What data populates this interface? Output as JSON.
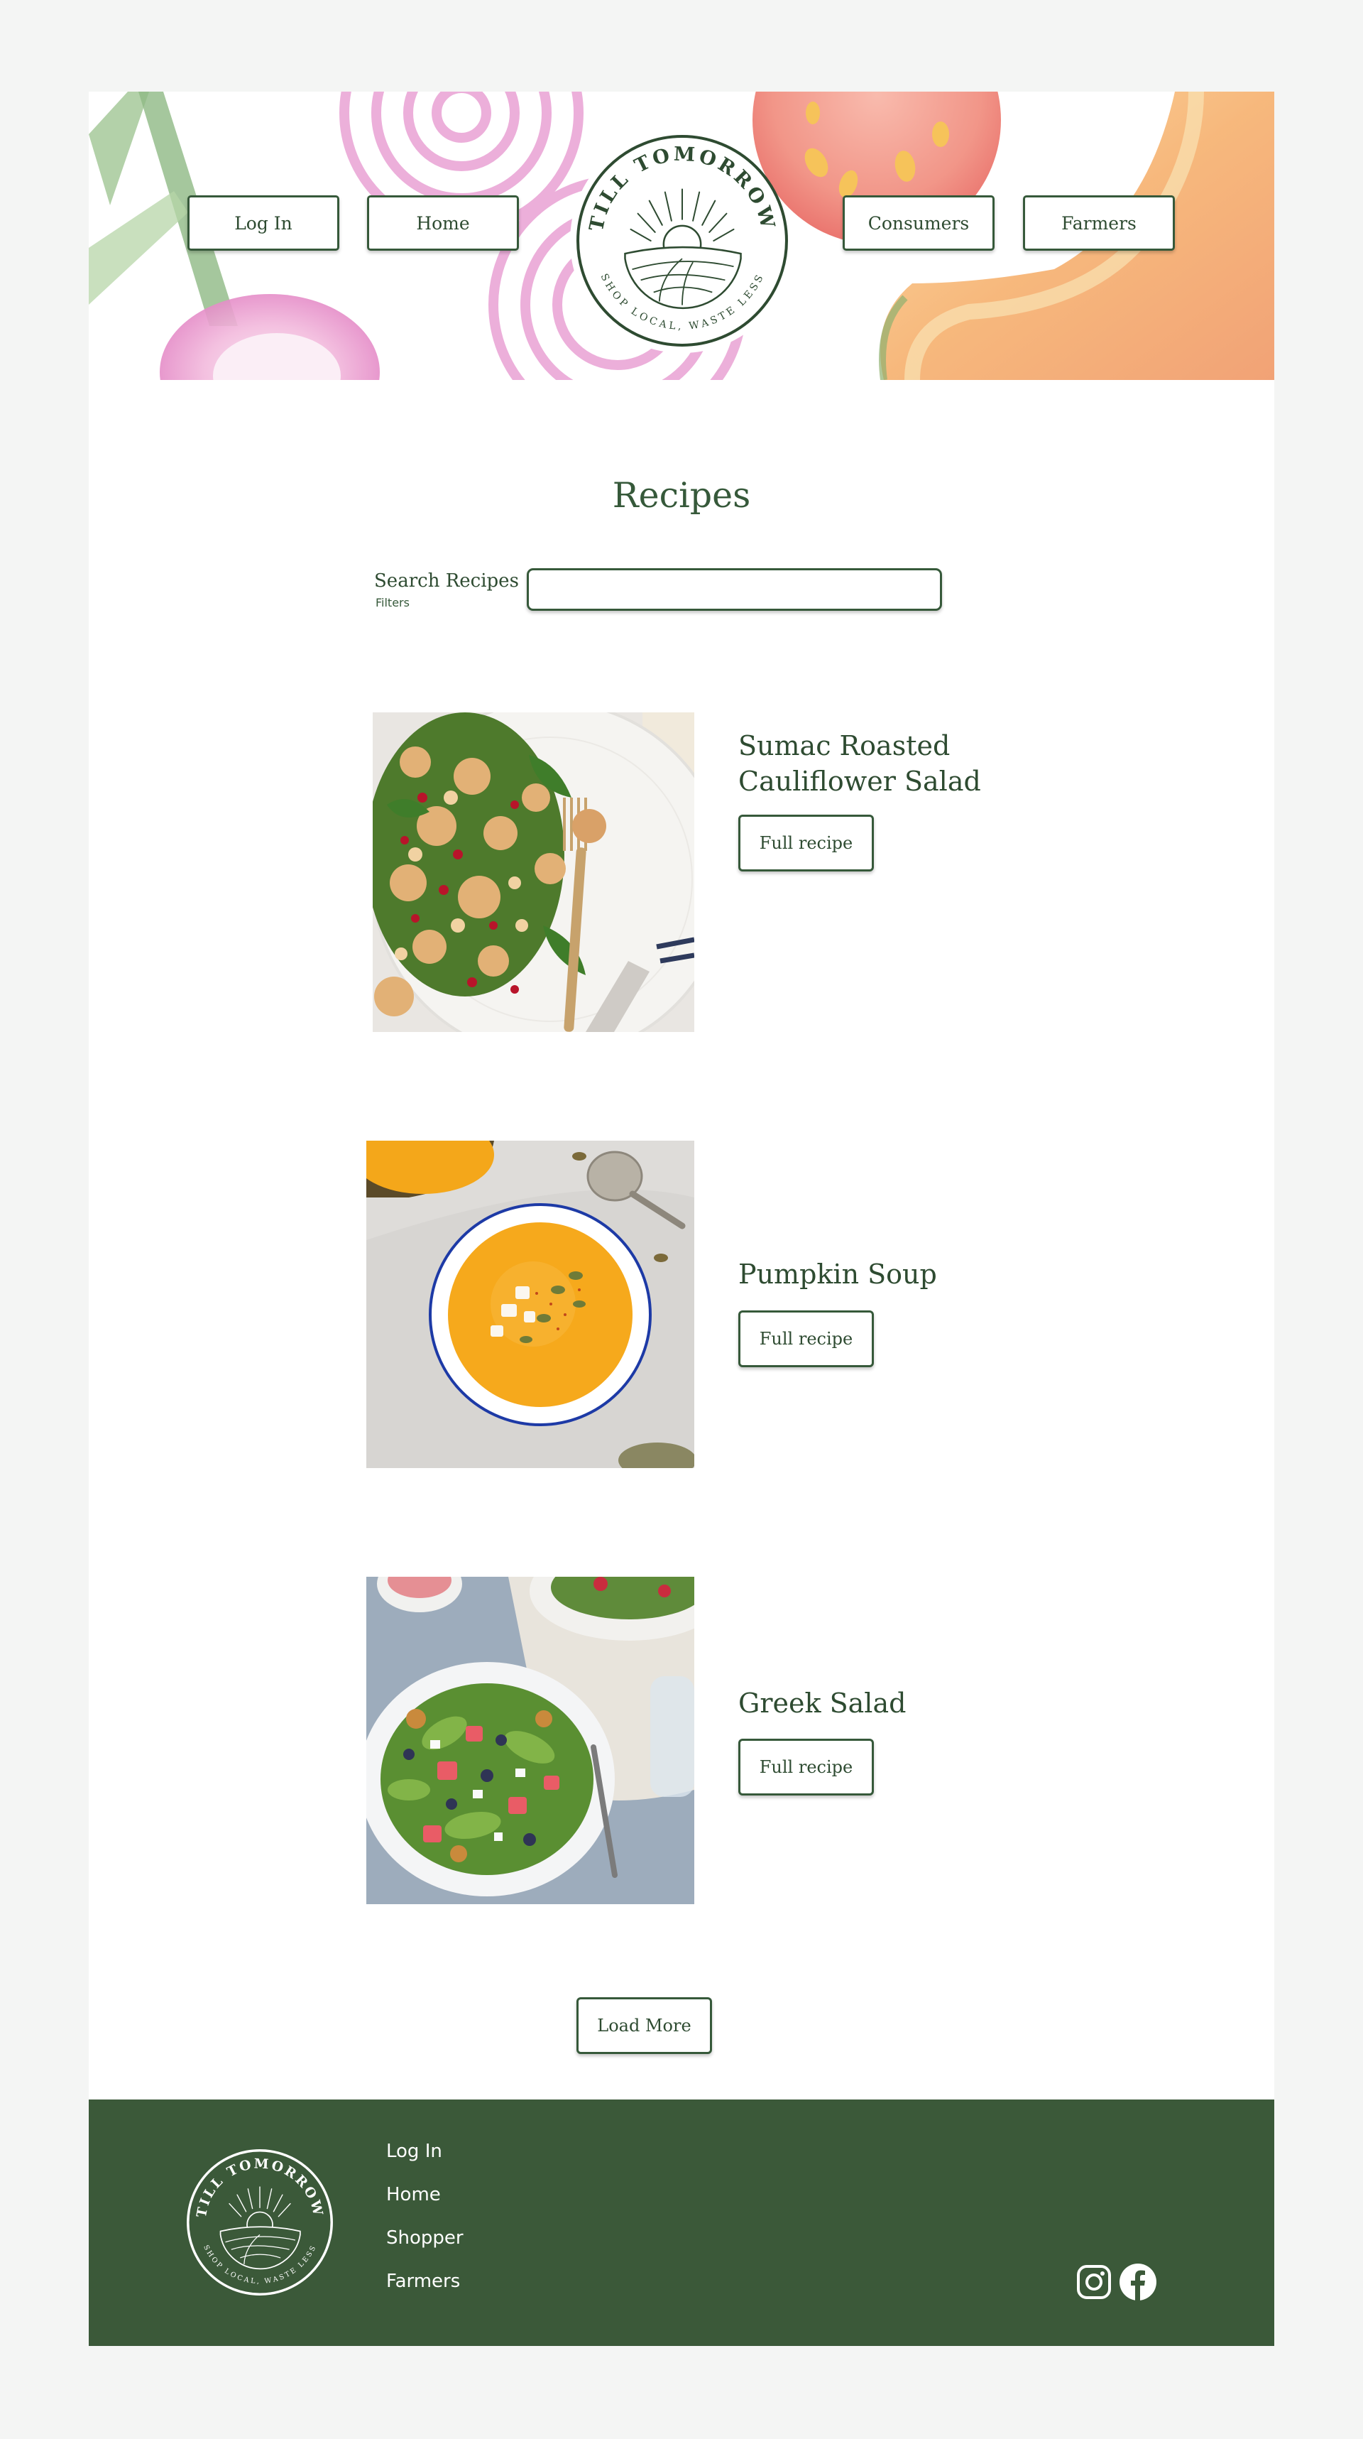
{
  "brand": {
    "name": "TILL TOMORROW",
    "tagline": "SHOP LOCAL, WASTE LESS"
  },
  "nav": {
    "login": "Log In",
    "home": "Home",
    "consumers": "Consumers",
    "farmers": "Farmers"
  },
  "page": {
    "title": "Recipes",
    "search_label": "Search Recipes",
    "filters_label": "Filters",
    "search_value": ""
  },
  "recipes": [
    {
      "title": "Sumac Roasted Cauliflower Salad",
      "button": "Full recipe",
      "image": "cauliflower-salad-photo"
    },
    {
      "title": "Pumpkin Soup",
      "button": "Full recipe",
      "image": "pumpkin-soup-photo"
    },
    {
      "title": "Greek Salad",
      "button": "Full recipe",
      "image": "greek-salad-photo"
    }
  ],
  "load_more": "Load More",
  "footer": {
    "links": [
      "Log In",
      "Home",
      "Shopper",
      "Farmers"
    ],
    "social": [
      "instagram-icon",
      "facebook-icon"
    ]
  },
  "colors": {
    "brand_green": "#36593a",
    "footer_green": "#3b5939",
    "page_bg": "#f4f5f4"
  }
}
